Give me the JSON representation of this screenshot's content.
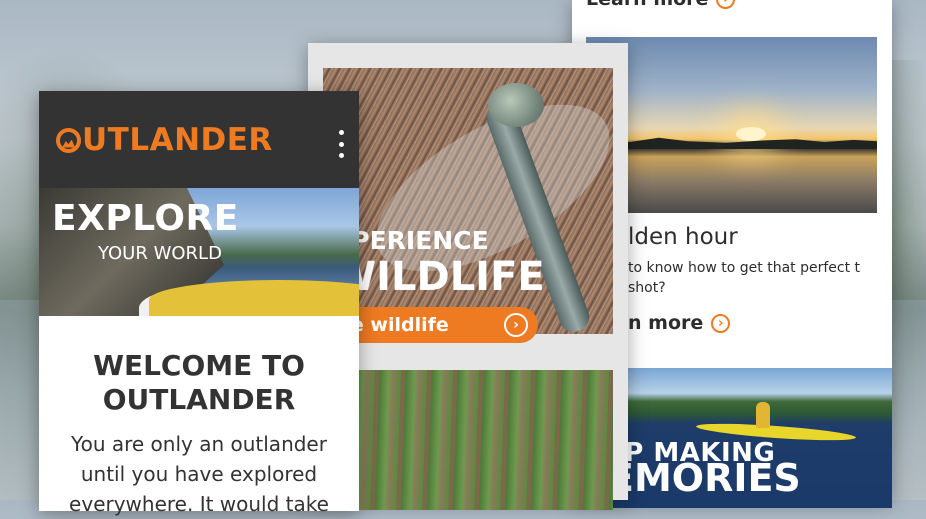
{
  "colors": {
    "accent": "#ee7a22",
    "header_bg": "#333333",
    "text": "#333333"
  },
  "icons": {
    "menu": "kebab-menu-icon",
    "arrow": "chevron-right-circle-icon",
    "logo": "mountain-o-logo-icon"
  },
  "front_card": {
    "logo_text": "UTLANDER",
    "hero_title": "EXPLORE",
    "hero_subtitle": "YOUR WORLD",
    "welcome_line1": "WELCOME TO",
    "welcome_line2": "OUTLANDER",
    "intro_text": "You are only an outlander until you have explored everywhere. It would take"
  },
  "middle_card": {
    "title_line1": "XPERIENCE",
    "title_line2": "WILDLIFE",
    "cta_label": "ee wildlife"
  },
  "right_card": {
    "top_link": "Learn more",
    "article_title": "lden hour",
    "article_desc": "to know how to get that perfect t shot?",
    "mid_link": "n more",
    "banner_line1": "EP MAKING",
    "banner_line2": "EMORIES"
  }
}
